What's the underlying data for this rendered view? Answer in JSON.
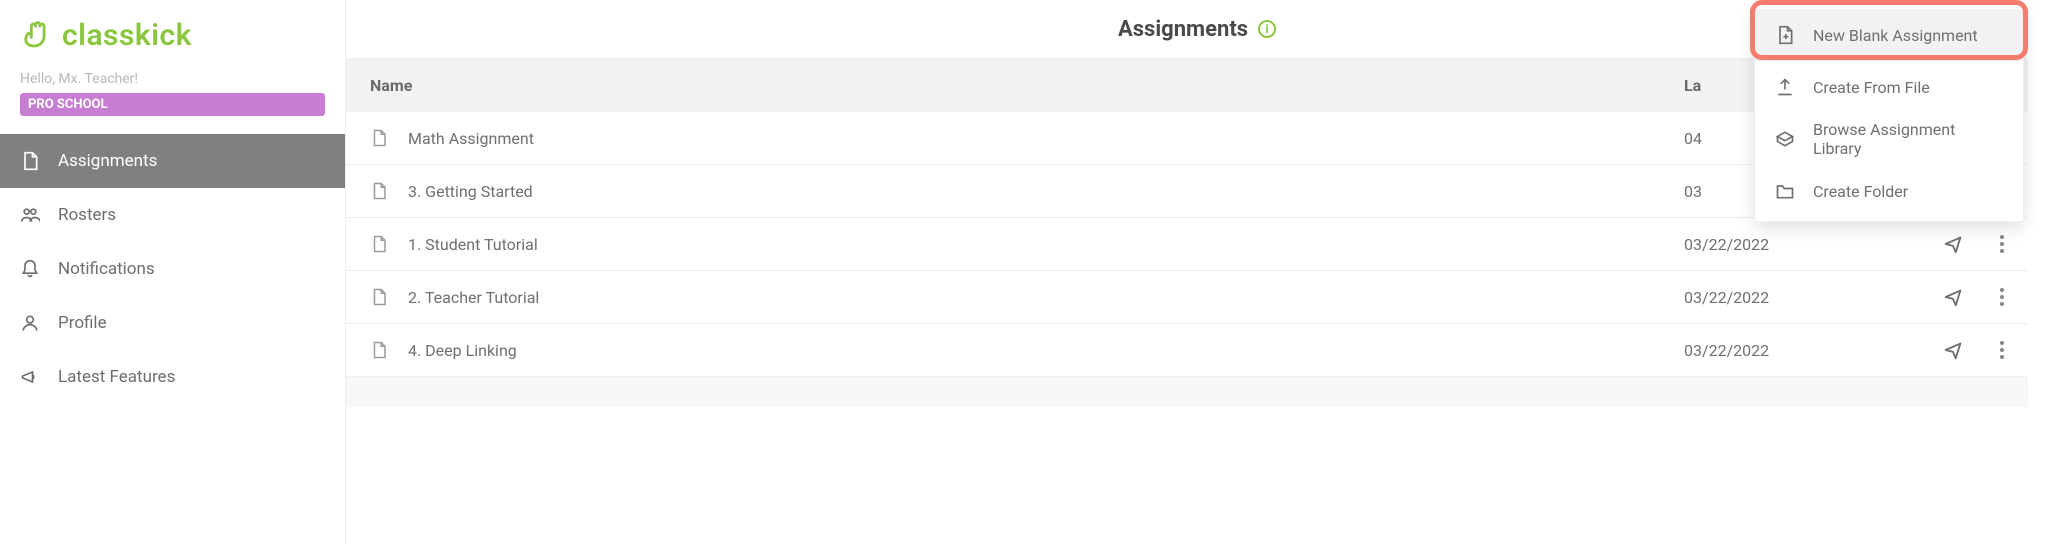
{
  "brand": {
    "name": "classkick"
  },
  "user": {
    "greeting": "Hello, Mx. Teacher!",
    "badge": "PRO SCHOOL"
  },
  "sidebar": {
    "items": [
      {
        "label": "Assignments",
        "icon": "document-icon",
        "active": true
      },
      {
        "label": "Rosters",
        "icon": "roster-icon",
        "active": false
      },
      {
        "label": "Notifications",
        "icon": "bell-icon",
        "active": false
      },
      {
        "label": "Profile",
        "icon": "person-icon",
        "active": false
      },
      {
        "label": "Latest Features",
        "icon": "megaphone-icon",
        "active": false
      }
    ]
  },
  "header": {
    "title": "Assignments"
  },
  "table": {
    "columns": {
      "name": "Name",
      "date": "La",
      "actions": ""
    },
    "rows": [
      {
        "name": "Math Assignment",
        "date": "04"
      },
      {
        "name": "3. Getting Started",
        "date": "03"
      },
      {
        "name": "1. Student Tutorial",
        "date": "03/22/2022"
      },
      {
        "name": "2. Teacher Tutorial",
        "date": "03/22/2022"
      },
      {
        "name": "4. Deep Linking",
        "date": "03/22/2022"
      }
    ]
  },
  "menu": {
    "items": [
      {
        "label": "New Blank Assignment",
        "icon": "document-plus-icon",
        "hover": true
      },
      {
        "label": "Create From File",
        "icon": "upload-icon",
        "hover": false
      },
      {
        "label": "Browse Assignment Library",
        "icon": "library-icon",
        "hover": false
      },
      {
        "label": "Create Folder",
        "icon": "folder-icon",
        "hover": false
      }
    ]
  }
}
